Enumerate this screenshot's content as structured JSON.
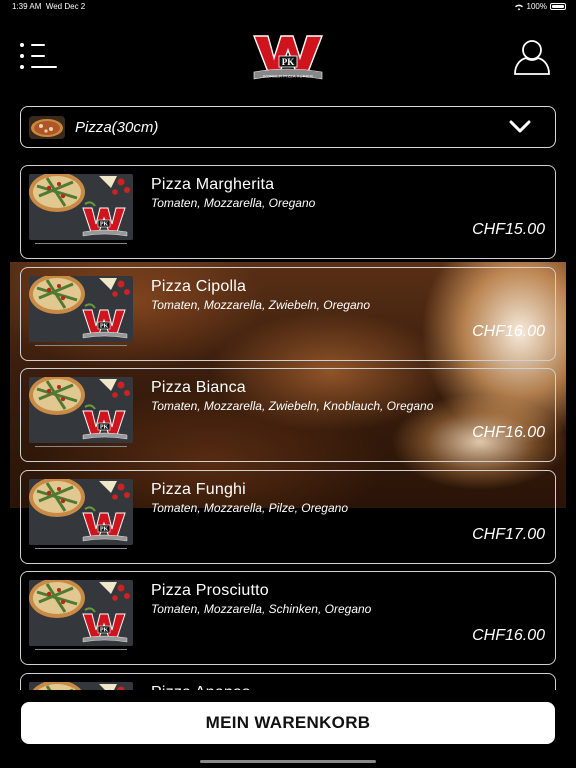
{
  "status_bar": {
    "time": "1:39 AM",
    "date": "Wed Dec 2",
    "battery": "100%"
  },
  "header": {
    "menu_icon": "menu-list-icon",
    "logo_text": "WPK",
    "logo_subtext": "WORBER PIZZA KURIER",
    "user_icon": "user-icon"
  },
  "category": {
    "label": "Pizza(30cm)",
    "chevron_icon": "chevron-down-icon"
  },
  "items": [
    {
      "name": "Pizza Margherita",
      "desc": "Tomaten, Mozzarella, Oregano",
      "price": "CHF15.00"
    },
    {
      "name": "Pizza Cipolla",
      "desc": "Tomaten, Mozzarella, Zwiebeln, Oregano",
      "price": "CHF16.00"
    },
    {
      "name": "Pizza Bianca",
      "desc": "Tomaten, Mozzarella, Zwiebeln, Knoblauch, Oregano",
      "price": "CHF16.00"
    },
    {
      "name": "Pizza Funghi",
      "desc": "Tomaten, Mozzarella, Pilze, Oregano",
      "price": "CHF17.00"
    },
    {
      "name": "Pizza Prosciutto",
      "desc": "Tomaten, Mozzarella, Schinken, Oregano",
      "price": "CHF16.00"
    },
    {
      "name": "Pizza Ananas",
      "desc": "",
      "price": ""
    }
  ],
  "cart": {
    "label": "MEIN WARENKORB"
  },
  "colors": {
    "background": "#000000",
    "border": "#d0d0d0",
    "logo_red": "#d0141e",
    "button_bg": "#ffffff"
  }
}
